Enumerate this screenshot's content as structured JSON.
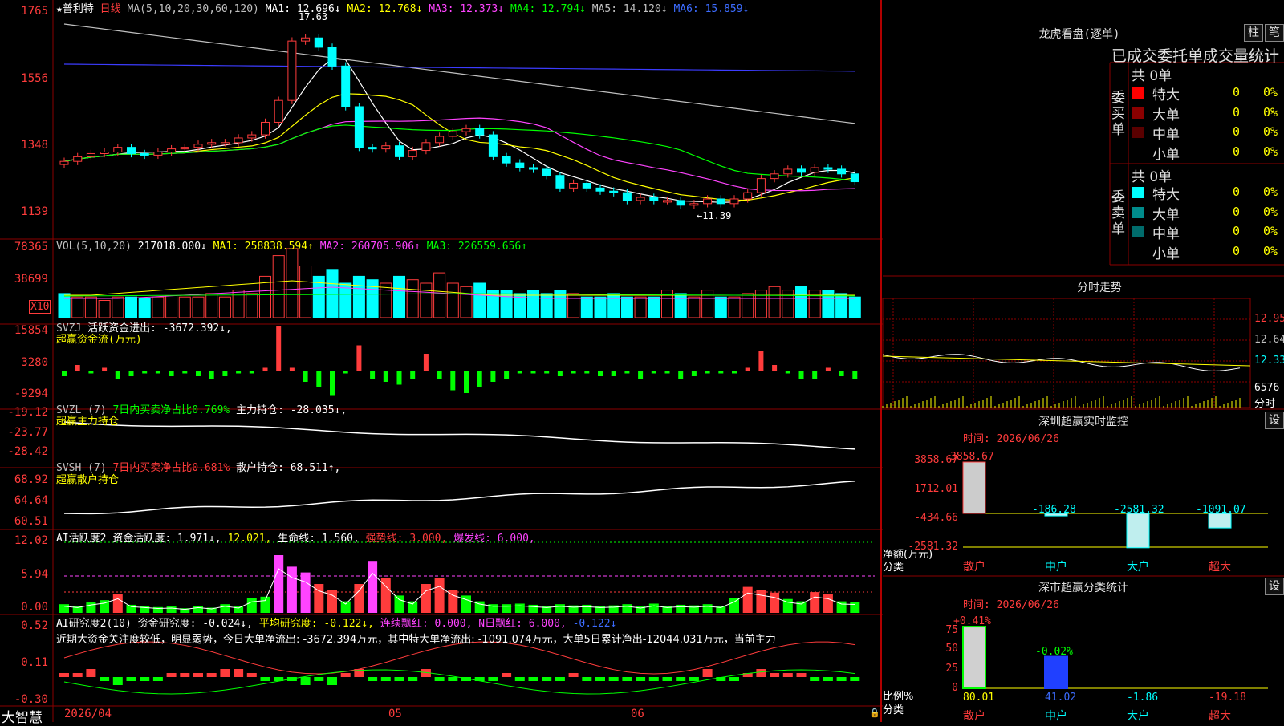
{
  "main_header": {
    "star": "★",
    "stock_name": "普利特",
    "period": "日线",
    "ma_def": "MA(5,10,20,30,60,120)",
    "ma1": "MA1: 12.696↓",
    "ma2": "MA2: 12.768↓",
    "ma3": "MA3: 12.373↓",
    "ma4": "MA4: 12.794↓",
    "ma5": "MA5: 14.120↓",
    "ma6": "MA6: 15.859↓"
  },
  "price_axis": [
    "1765",
    "1556",
    "1348",
    "1139"
  ],
  "price_annotations": {
    "high": "17.63",
    "low": "←11.39"
  },
  "vol_header": {
    "label": "VOL(5,10,20)",
    "value": "217018.000↓",
    "ma1": "MA1: 258838.594↑",
    "ma2": "MA2: 260705.906↑",
    "ma3": "MA3: 226559.656↑"
  },
  "vol_axis": [
    "78365",
    "38699"
  ],
  "vol_unit": "X10",
  "svzj_header": {
    "label": "SVZJ",
    "text": "活跃资金进出: -3672.392↓,",
    "sub": "超赢资金流(万元)"
  },
  "svzj_axis": [
    "15854",
    "3280",
    "-9294"
  ],
  "svzl_header": {
    "label": "SVZL (7)",
    "pct": "7日内买卖净占比0.769%",
    "text": "主力持仓: -28.035↓,",
    "sub": "超赢主力持仓"
  },
  "svzl_axis": [
    "-19.12",
    "-23.77",
    "-28.42"
  ],
  "svsh_header": {
    "label": "SVSH (7)",
    "pct": "7日内买卖净占比0.681%",
    "text": "散户持仓: 68.511↑,",
    "sub": "超赢散户持仓"
  },
  "svsh_axis": [
    "68.92",
    "64.64",
    "60.51"
  ],
  "ai1_header": {
    "label": "AI活跃度2",
    "text": "资金活跃度: 1.971↓,",
    "v2": "12.021,",
    "life": "生命线: 1.560,",
    "strong": "强势线: 3.000,",
    "burst": "爆发线: 6.000,"
  },
  "ai1_axis": [
    "12.02",
    "5.94",
    "0.00"
  ],
  "ai2_header": {
    "label": "AI研究度2(10)",
    "text": "资金研究度: -0.024↓,",
    "avg": "平均研究度: -0.122↓,",
    "cont": "连续飘红: 0.000,",
    "nday": "N日飘红: 6.000,",
    "last": "-0.122↓"
  },
  "ai2_axis": [
    "0.52",
    "0.11",
    "-0.30"
  ],
  "ai2_comment": "近期大资金关注度较低，明显弱势，今日大单净流出: -3672.394万元，其中特大单净流出: -1091.074万元，大单5日累计净出-12044.031万元，当前主力",
  "bottom_bar": {
    "brand": "大智慧",
    "date_start": "2026/04",
    "m05": "05",
    "m06": "06"
  },
  "colors": {
    "up": "#ff3c3c",
    "down": "#00ffff",
    "grid": "#8b0000",
    "ma1": "#ffffff",
    "ma2": "#ffff00",
    "ma3": "#ff44ff",
    "ma4": "#00ff00",
    "ma5": "#c0c0c0",
    "ma6": "#3c3cff"
  },
  "side": {
    "lhb_title": "龙虎看盘(逐单)",
    "btn_zhu": "柱",
    "btn_bi": "笔",
    "stat_title": "已成交委托单成交量统计",
    "buy_group": {
      "title": "委买单",
      "count": "共 0单",
      "rows": [
        {
          "label": "特大",
          "color": "#ff0000",
          "v": "0",
          "p": "0%"
        },
        {
          "label": "大单",
          "color": "#8b0000",
          "v": "0",
          "p": "0%"
        },
        {
          "label": "中单",
          "color": "#5a0000",
          "v": "0",
          "p": "0%"
        },
        {
          "label": "小单",
          "color": "#000000",
          "v": "0",
          "p": "0%"
        }
      ]
    },
    "sell_group": {
      "title": "委卖单",
      "count": "共 0单",
      "rows": [
        {
          "label": "特大",
          "color": "#00ffff",
          "v": "0",
          "p": "0%"
        },
        {
          "label": "大单",
          "color": "#008b8b",
          "v": "0",
          "p": "0%"
        },
        {
          "label": "中单",
          "color": "#006b6b",
          "v": "0",
          "p": "0%"
        },
        {
          "label": "小单",
          "color": "#000000",
          "v": "0",
          "p": "0%"
        }
      ]
    },
    "fenshi_title": "分时走势",
    "fenshi_axis": [
      "12.95",
      "12.64",
      "12.33",
      "6576",
      "分时"
    ],
    "sz_monitor": {
      "title": "深圳超赢实时监控",
      "set": "设",
      "date": "时间: 2026/06/26",
      "axis": [
        "3858.67",
        "1712.01",
        "-434.66",
        "-2581.32"
      ],
      "unit1": "净额(万元)",
      "unit2": "分类",
      "bars": [
        {
          "name": "散户",
          "value": 3858.67,
          "label": "3858.67"
        },
        {
          "name": "中户",
          "value": -186.28,
          "label": "-186.28"
        },
        {
          "name": "大户",
          "value": -2581.32,
          "label": "-2581.32"
        },
        {
          "name": "超大",
          "value": -1091.07,
          "label": "-1091.07"
        }
      ]
    },
    "sz_class": {
      "title": "深市超赢分类统计",
      "set": "设",
      "date": "时间: 2026/06/26",
      "axis": [
        "75",
        "50",
        "25",
        "0"
      ],
      "unit1": "比例%",
      "unit2": "分类",
      "bars": [
        {
          "name": "散户",
          "top": "+0.41%",
          "bottom": "80.01",
          "value": 80.01
        },
        {
          "name": "中户",
          "top": "-0.02%",
          "bottom": "41.02",
          "value": 41.02
        },
        {
          "name": "大户",
          "top": "",
          "bottom": "-1.86",
          "value": -1.86
        },
        {
          "name": "超大",
          "top": "",
          "bottom": "-19.18",
          "value": -19.18
        }
      ]
    }
  }
}
